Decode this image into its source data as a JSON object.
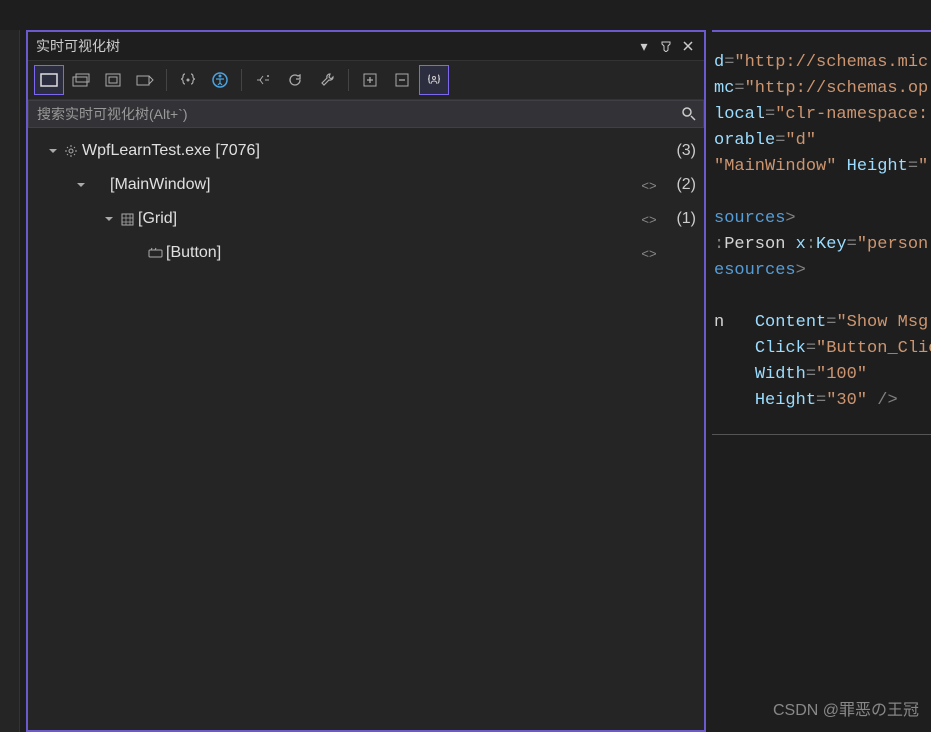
{
  "panel": {
    "title": "实时可视化树",
    "search_placeholder": "搜索实时可视化树(Alt+`)"
  },
  "tree": {
    "nodes": [
      {
        "label": "WpfLearnTest.exe [7076]",
        "count": "(3)",
        "indent": 0,
        "expander": true,
        "icon": "gear"
      },
      {
        "label": "[MainWindow]",
        "count": "(2)",
        "indent": 1,
        "expander": true,
        "icon": "",
        "tags": true
      },
      {
        "label": "[Grid]",
        "count": "(1)",
        "indent": 2,
        "expander": true,
        "icon": "grid",
        "tags": true
      },
      {
        "label": "[Button]",
        "count": "",
        "indent": 3,
        "expander": false,
        "icon": "button",
        "tags": true
      }
    ]
  },
  "code": {
    "l1a": "d",
    "l1b": "=",
    "l1c": "\"http://schemas.mic",
    "l2a": "mc",
    "l2b": "=",
    "l2c": "\"http://schemas.op",
    "l3a": "local",
    "l3b": "=",
    "l3c": "\"clr-namespace:",
    "l4a": "orable",
    "l4b": "=",
    "l4c": "\"d\"",
    "l5a": "\"MainWindow\"",
    "l5b": " Height",
    "l5c": "=",
    "l5d": "\"",
    "l6": "sources",
    "l6b": ">",
    "l7a": ":",
    "l7b": "Person ",
    "l7c": "x",
    "l7d": ":",
    "l7e": "Key",
    "l7f": "=",
    "l7g": "\"person",
    "l8": "esources",
    "l8b": ">",
    "l9a": "n   ",
    "l9b": "Content",
    "l9c": "=",
    "l9d": "\"Show Msg!",
    "l10a": "Click",
    "l10b": "=",
    "l10c": "\"Button_Clic",
    "l11a": "Width",
    "l11b": "=",
    "l11c": "\"100\"",
    "l12a": "Height",
    "l12b": "=",
    "l12c": "\"30\"",
    "l12d": " />"
  },
  "watermark": "CSDN @罪恶の王冠"
}
